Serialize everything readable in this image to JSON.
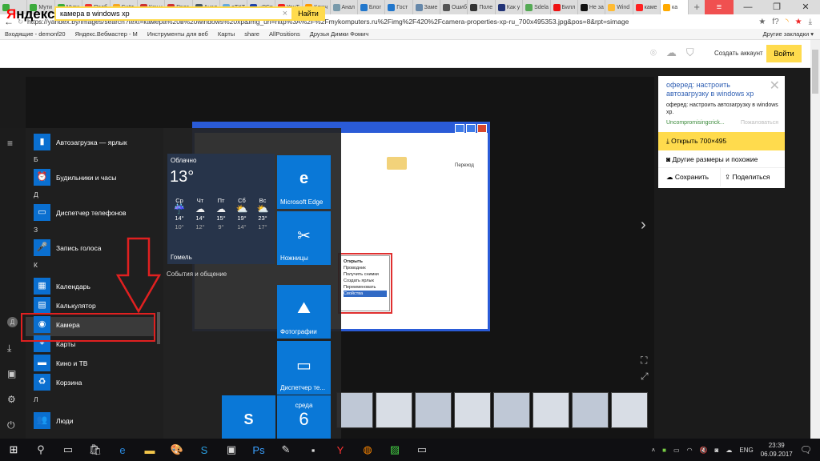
{
  "browser": {
    "tabs": [
      {
        "label": "",
        "color": "#3cab3c"
      },
      {
        "label": "Мути",
        "color": "#3cab3c"
      },
      {
        "label": "Мути",
        "color": "#3cab3c"
      },
      {
        "label": "Подб",
        "color": "#e33"
      },
      {
        "label": "Счёт",
        "color": "#f5a623"
      },
      {
        "label": "Как н",
        "color": "#c33"
      },
      {
        "label": "Реда",
        "color": "#c33"
      },
      {
        "label": "Анал",
        "color": "#456"
      },
      {
        "label": "eTXT",
        "color": "#6ad"
      },
      {
        "label": "«PCp",
        "color": "#24a"
      },
      {
        "label": "YouT",
        "color": "#e22"
      },
      {
        "label": "Ключ",
        "color": "#f90"
      },
      {
        "label": "Анал",
        "color": "#79a"
      },
      {
        "label": "Блог",
        "color": "#27c"
      },
      {
        "label": "Гост",
        "color": "#27c"
      },
      {
        "label": "Заме",
        "color": "#68a"
      },
      {
        "label": "Ошиб",
        "color": "#555"
      },
      {
        "label": "Поле",
        "color": "#333"
      },
      {
        "label": "Как у",
        "color": "#237"
      },
      {
        "label": "Sdela",
        "color": "#5a5"
      },
      {
        "label": "Билл",
        "color": "#e11"
      },
      {
        "label": "Не за",
        "color": "#111"
      },
      {
        "label": "Wind",
        "color": "#fb3"
      },
      {
        "label": "каме",
        "color": "#f22"
      },
      {
        "label": "ка",
        "color": "#fa0"
      }
    ],
    "new_tab": "+",
    "window_controls": {
      "menu": "≡",
      "minimize": "—",
      "restore": "❐",
      "close": "✕"
    },
    "url": "https://yandex.by/images/search?text=камера%20в%20windows%20xp&img_url=http%3A%2F%2Fmykomputers.ru%2Fimg%2F420%2Fcamera-properties-xp-ru_700x495353.jpg&pos=8&rpt=simage",
    "bookmarks": [
      "Входящие - demonf20",
      "Яндекс.Вебмастер - М",
      "Инструменты для веб",
      "Карты",
      "share",
      "AllPositions",
      "Друзья Димки Фомич"
    ],
    "other_bookmarks": "Другие закладки ▾"
  },
  "yandex": {
    "logo": "Яндекс",
    "logo_first": "Я",
    "logo_rest": "ндекс",
    "search_value": "камера в windows xp",
    "search_button": "Найти",
    "create_account": "Создать аккаунт",
    "login": "Войти"
  },
  "viewer": {
    "title": "оферед: настроить автозагрузку в windows xp",
    "description": "оферед: настроить автозагрузку в windows xp.",
    "source": "Uncompromisingcrick...",
    "report": "Пожаловаться",
    "open": "Открыть  700×495",
    "other_sizes": "Другие размеры и похожие",
    "save": "Сохранить",
    "share": "Поделиться",
    "xp_go": "Переход",
    "context_menu": [
      "Открыть",
      "Проводник",
      "Получить снимки",
      "Создать ярлык",
      "Переименовать",
      "Свойства"
    ]
  },
  "start_menu": {
    "items": [
      {
        "type": "app",
        "label": "Автозагрузка — ярлык",
        "icon": "▮"
      },
      {
        "type": "letter",
        "label": "Б"
      },
      {
        "type": "app",
        "label": "Будильники и часы",
        "icon": "⏰"
      },
      {
        "type": "letter",
        "label": "Д"
      },
      {
        "type": "app",
        "label": "Диспетчер телефонов",
        "icon": "▭"
      },
      {
        "type": "letter",
        "label": "З"
      },
      {
        "type": "app",
        "label": "Запись голоса",
        "icon": "🎤"
      },
      {
        "type": "letter",
        "label": "К"
      },
      {
        "type": "app",
        "label": "Календарь",
        "icon": "▦"
      },
      {
        "type": "app",
        "label": "Калькулятор",
        "icon": "▤"
      },
      {
        "type": "app",
        "label": "Камера",
        "icon": "◉"
      },
      {
        "type": "app",
        "label": "Карты",
        "icon": "⌖"
      },
      {
        "type": "app",
        "label": "Кино и ТВ",
        "icon": "▬"
      },
      {
        "type": "app",
        "label": "Корзина",
        "icon": "♻"
      },
      {
        "type": "letter",
        "label": "Л"
      },
      {
        "type": "app",
        "label": "Люди",
        "icon": "👥"
      }
    ],
    "user_initial": "Д",
    "weather": {
      "condition": "Облачно",
      "temp": "13°",
      "city": "Гомель",
      "days": [
        {
          "d": "Ср",
          "hi": "14°",
          "lo": "10°",
          "icon": "rain"
        },
        {
          "d": "Чт",
          "hi": "14°",
          "lo": "12°",
          "icon": "cloud"
        },
        {
          "d": "Пт",
          "hi": "15°",
          "lo": "9°",
          "icon": "cloud"
        },
        {
          "d": "Сб",
          "hi": "19°",
          "lo": "14°",
          "icon": "sun"
        },
        {
          "d": "Вс",
          "hi": "23°",
          "lo": "17°",
          "icon": "sun"
        }
      ]
    },
    "tiles": {
      "edge": "Microsoft Edge",
      "snipping": "Ножницы",
      "photos": "Фотографии",
      "phone": "Диспетчер те...",
      "calendar_day": "среда",
      "calendar_date": "6"
    },
    "group_label": "События и общение"
  },
  "taskbar": {
    "lang": "ENG",
    "time": "23:39",
    "date": "06.09.2017"
  }
}
